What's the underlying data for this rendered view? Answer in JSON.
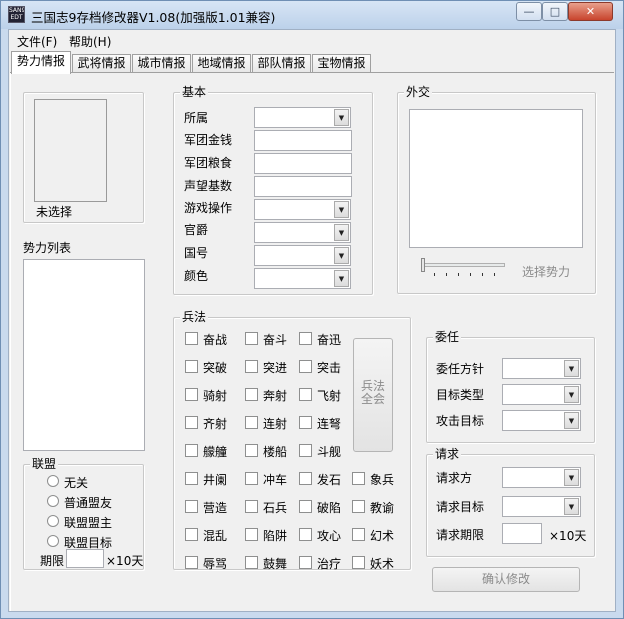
{
  "window": {
    "title": "三国志9存档修改器V1.08(加强版1.01兼容)",
    "icon_text": "SAN9 EDT",
    "controls": {
      "minimize": "—",
      "maximize": "□",
      "close": "✕"
    }
  },
  "menu": [
    "文件(F)",
    "帮助(H)"
  ],
  "tabs": [
    {
      "label": "势力情报",
      "active": true
    },
    {
      "label": "武将情报",
      "active": false
    },
    {
      "label": "城市情报",
      "active": false
    },
    {
      "label": "地域情报",
      "active": false
    },
    {
      "label": "部队情报",
      "active": false
    },
    {
      "label": "宝物情报",
      "active": false
    }
  ],
  "left": {
    "portrait_caption": "未选择",
    "force_list_label": "势力列表",
    "alliance": {
      "title": "联盟",
      "options": [
        "无关",
        "普通盟友",
        "联盟盟主",
        "联盟目标"
      ],
      "term_label": "期限",
      "term_unit": "×10天"
    }
  },
  "basic": {
    "title": "基本",
    "fields": [
      {
        "label": "所属",
        "type": "combo",
        "value": ""
      },
      {
        "label": "军团金钱",
        "type": "text",
        "value": ""
      },
      {
        "label": "军团粮食",
        "type": "text",
        "value": ""
      },
      {
        "label": "声望基数",
        "type": "text",
        "value": ""
      },
      {
        "label": "游戏操作",
        "type": "combo",
        "value": ""
      },
      {
        "label": "官爵",
        "type": "combo",
        "value": ""
      },
      {
        "label": "国号",
        "type": "combo",
        "value": ""
      },
      {
        "label": "颜色",
        "type": "combo",
        "value": ""
      }
    ]
  },
  "diplomacy": {
    "title": "外交",
    "select_label": "选择势力",
    "slider_value": 0
  },
  "tactics": {
    "title": "兵法",
    "rows": [
      [
        "奋战",
        "奋斗",
        "奋迅"
      ],
      [
        "突破",
        "突进",
        "突击"
      ],
      [
        "骑射",
        "奔射",
        "飞射"
      ],
      [
        "齐射",
        "连射",
        "连弩"
      ],
      [
        "艨艟",
        "楼船",
        "斗舰"
      ],
      [
        "井阑",
        "冲车",
        "发石",
        "象兵"
      ],
      [
        "营造",
        "石兵",
        "破陷",
        "教谕"
      ],
      [
        "混乱",
        "陷阱",
        "攻心",
        "幻术"
      ],
      [
        "辱骂",
        "鼓舞",
        "治疗",
        "妖术"
      ]
    ],
    "all_button": [
      "兵法",
      "全会"
    ]
  },
  "delegate": {
    "title": "委任",
    "fields": [
      "委任方针",
      "目标类型",
      "攻击目标"
    ]
  },
  "request": {
    "title": "请求",
    "fields": [
      "请求方",
      "请求目标"
    ],
    "term_label": "请求期限",
    "term_unit": "×10天"
  },
  "confirm_button": "确认修改"
}
